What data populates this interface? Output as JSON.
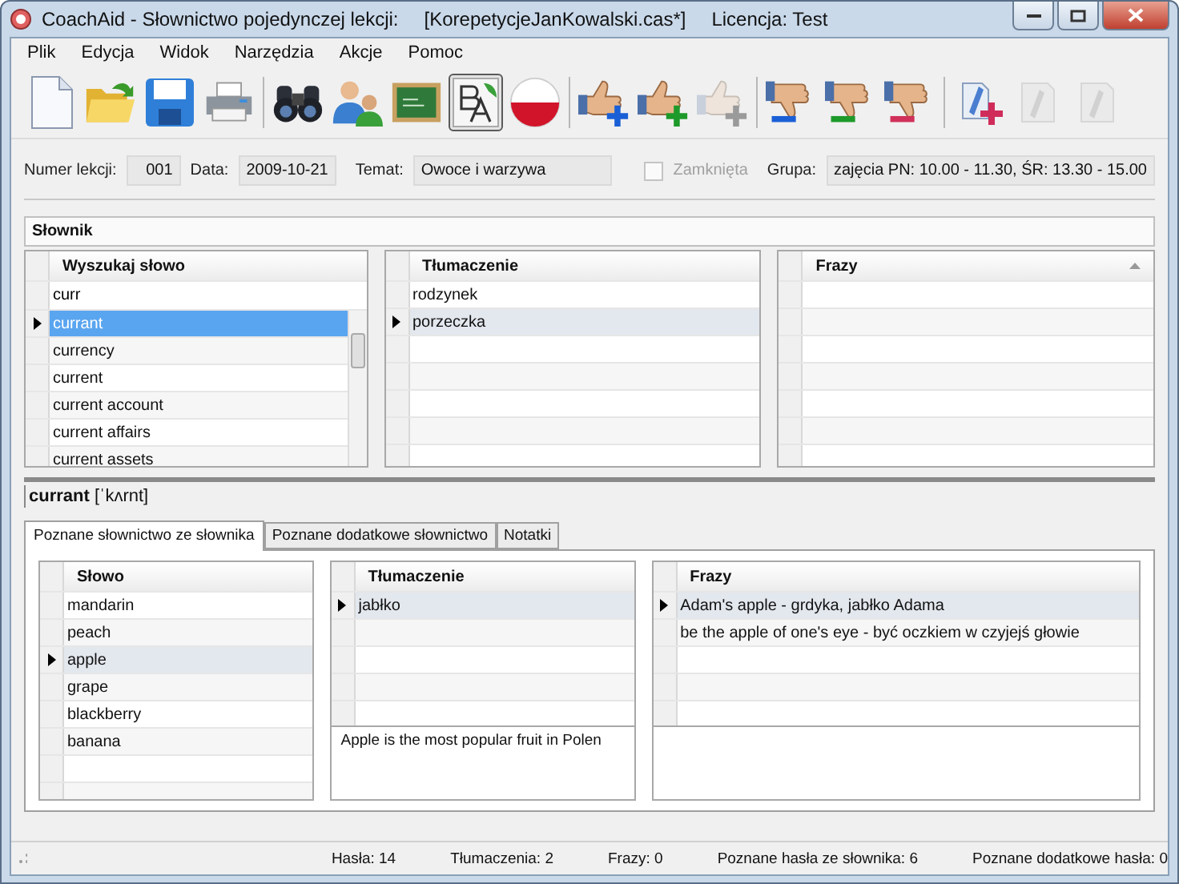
{
  "window": {
    "title": "CoachAid - Słownictwo pojedynczej lekcji:",
    "file": "[KorepetycjeJanKowalski.cas*]",
    "license": "Licencja: Test"
  },
  "menu": [
    "Plik",
    "Edycja",
    "Widok",
    "Narzędzia",
    "Akcje",
    "Pomoc"
  ],
  "toolbar": [
    {
      "kind": "document",
      "disabled": false,
      "selected": false
    },
    {
      "kind": "folder",
      "disabled": false,
      "selected": false
    },
    {
      "kind": "floppy",
      "disabled": false,
      "selected": false
    },
    {
      "kind": "printer",
      "disabled": false,
      "selected": false
    },
    {
      "kind": "separator"
    },
    {
      "kind": "binoculars",
      "disabled": false,
      "selected": false
    },
    {
      "kind": "people",
      "disabled": false,
      "selected": false
    },
    {
      "kind": "chalkboard",
      "disabled": false,
      "selected": false
    },
    {
      "kind": "letters",
      "disabled": false,
      "selected": true
    },
    {
      "kind": "flag",
      "disabled": false,
      "selected": false
    },
    {
      "kind": "separator"
    },
    {
      "kind": "thumbs-up",
      "disabled": false,
      "selected": false,
      "color": "#1a5fd6"
    },
    {
      "kind": "thumbs-up",
      "disabled": false,
      "selected": false,
      "color": "#1e9a2a"
    },
    {
      "kind": "thumbs-up",
      "disabled": true,
      "selected": false,
      "color": "#9a9a9a"
    },
    {
      "kind": "separator"
    },
    {
      "kind": "thumbs-down",
      "disabled": false,
      "selected": false,
      "color": "#1a5fd6"
    },
    {
      "kind": "thumbs-down",
      "disabled": false,
      "selected": false,
      "color": "#1e9a2a"
    },
    {
      "kind": "thumbs-down",
      "disabled": false,
      "selected": false,
      "color": "#d0305a"
    },
    {
      "kind": "separator"
    },
    {
      "kind": "note-plus",
      "disabled": false,
      "selected": false
    },
    {
      "kind": "note",
      "disabled": true,
      "selected": false
    },
    {
      "kind": "note",
      "disabled": true,
      "selected": false
    }
  ],
  "lesson": {
    "number_label": "Numer lekcji:",
    "number": "001",
    "date_label": "Data:",
    "date": "2009-10-21",
    "topic_label": "Temat:",
    "topic": "Owoce i warzywa",
    "closed": {
      "label": "Zamknięta",
      "checked": false,
      "disabled": true
    },
    "group_label": "Grupa:",
    "group": "zajęcia PN: 10.00 - 11.30, ŚR: 13.30 - 15.00"
  },
  "dictionary": {
    "title": "Słownik",
    "search": {
      "header": "Wyszukaj słowo",
      "value": "curr",
      "results": [
        {
          "word": "currant",
          "selected": true
        },
        {
          "word": "currency",
          "selected": false
        },
        {
          "word": "current",
          "selected": false
        },
        {
          "word": "current account",
          "selected": false
        },
        {
          "word": "current affairs",
          "selected": false
        },
        {
          "word": "current assets",
          "selected": false
        }
      ]
    },
    "translations": {
      "header": "Tłumaczenie",
      "rows": [
        {
          "text": "rodzynek",
          "selected": false
        },
        {
          "text": "porzeczka",
          "selected": true
        }
      ]
    },
    "phrases": {
      "header": "Frazy"
    }
  },
  "entry": {
    "word": "currant",
    "pronunciation": "[ˈkʌrnt]"
  },
  "tabs": [
    {
      "label": "Poznane słownictwo ze słownika",
      "selected": true
    },
    {
      "label": "Poznane dodatkowe słownictwo",
      "selected": false
    },
    {
      "label": "Notatki",
      "selected": false
    }
  ],
  "learned": {
    "words": {
      "header": "Słowo",
      "rows": [
        {
          "text": "mandarin",
          "selected": false
        },
        {
          "text": "peach",
          "selected": false
        },
        {
          "text": "apple",
          "selected": true
        },
        {
          "text": "grape",
          "selected": false
        },
        {
          "text": "blackberry",
          "selected": false
        },
        {
          "text": "banana",
          "selected": false
        }
      ]
    },
    "translations": {
      "header": "Tłumaczenie",
      "rows": [
        {
          "text": "jabłko",
          "selected": true
        }
      ],
      "note": "Apple is the most popular fruit in Polen"
    },
    "phrases": {
      "header": "Frazy",
      "rows": [
        {
          "text": "Adam's apple - grdyka, jabłko Adama",
          "selected": true
        },
        {
          "text": "be the apple of one's eye - być oczkiem w czyjejś głowie",
          "selected": false
        }
      ]
    }
  },
  "status_bar": [
    "Hasła: 14",
    "Tłumaczenia: 2",
    "Frazy: 0",
    "Poznane hasła ze słownika: 6",
    "Poznane dodatkowe hasła: 0"
  ]
}
